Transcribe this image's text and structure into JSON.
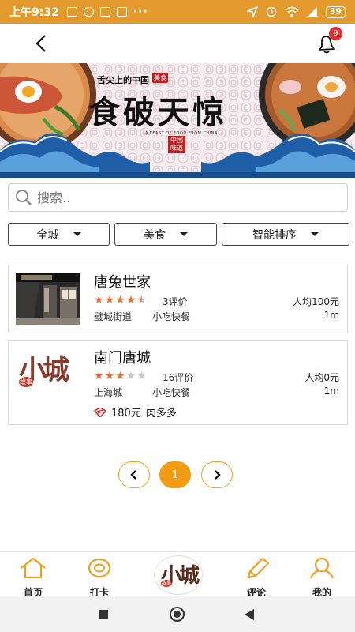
{
  "status_bar": {
    "time": "上午9:32",
    "overflow": "···",
    "battery": "39"
  },
  "nav": {
    "notification_count": "9"
  },
  "banner": {
    "subtitle": "舌尖上的中国",
    "subtitle_tag": "美食",
    "title": "食破天惊",
    "english": "A FEAST OF FOOD FROM CHINA",
    "seal": "中国味道"
  },
  "search": {
    "placeholder": "搜索.."
  },
  "filters": [
    {
      "label": "全城"
    },
    {
      "label": "美食"
    },
    {
      "label": "智能排序"
    }
  ],
  "restaurants": [
    {
      "name": "唐兔世家",
      "rating": 4.5,
      "reviews": "3评价",
      "avg_price": "人均100元",
      "area": "璧城街道",
      "cuisine": "小吃快餐",
      "distance": "1m"
    },
    {
      "name": "南门唐城",
      "rating": 3,
      "reviews": "16评价",
      "avg_price": "人均0元",
      "area": "上海城",
      "cuisine": "小吃快餐",
      "distance": "1m",
      "deal_price": "180元",
      "deal_name": "肉多多",
      "logo_main": "小城",
      "logo_sub": "故事"
    }
  ],
  "pagination": {
    "current": "1"
  },
  "tabbar": {
    "items": [
      {
        "label": "首页",
        "icon": "home-icon"
      },
      {
        "label": "打卡",
        "icon": "checkin-icon"
      },
      {
        "label": "评论",
        "icon": "pencil-icon"
      },
      {
        "label": "我的",
        "icon": "user-icon"
      }
    ],
    "center_logo_main": "小城",
    "center_logo_sub": "故事"
  },
  "colors": {
    "accent": "#f39c12",
    "status_bar": "#e39a2c",
    "star": "#e8703a",
    "badge": "#e03131"
  }
}
